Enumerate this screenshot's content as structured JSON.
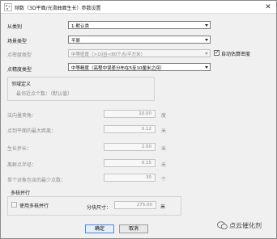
{
  "window": {
    "title": "频数（3D平面/光滑曲面生长）参数设置",
    "close_label": "✕"
  },
  "form": {
    "category_label": "从类别",
    "category_value": "1-默认类",
    "scene_label": "场景类型",
    "scene_value": "平原",
    "density_label": "点密度类型",
    "density_value": "中等密度（>10且<80个点/平方米）",
    "auto_estimate_label": "自动估算密度",
    "cloud_label": "点精度类型",
    "cloud_value": "中等精度（高程中误差分布在5至10厘米之间）"
  },
  "group_def": {
    "title": "邻域定义",
    "min_neighbors_label": "最邻近点个数：（默认值）"
  },
  "params": [
    {
      "label": "法向量夹角：",
      "value": "10.00",
      "unit": "度"
    },
    {
      "label": "点到平面的最大距离：",
      "value": "0.12",
      "unit": "米"
    },
    {
      "label": "生长步长：",
      "value": "2.00",
      "unit": "米"
    },
    {
      "label": "离群点半径：",
      "value": "0.15",
      "unit": "米"
    },
    {
      "label": "单个对象包含的最少点数：",
      "value": "30",
      "unit": "个"
    }
  ],
  "multi": {
    "title": "多核并行",
    "checkbox_label": "使用多核并行",
    "block_label": "分块尺寸：",
    "block_value": "275.00",
    "block_unit": "米"
  },
  "buttons": {
    "ok": "确定",
    "cancel": "取消"
  },
  "watermark": "点云催化剂",
  "colors": {
    "primary_border": "#4a8ad8",
    "window_bg": "#f0f0f0"
  }
}
